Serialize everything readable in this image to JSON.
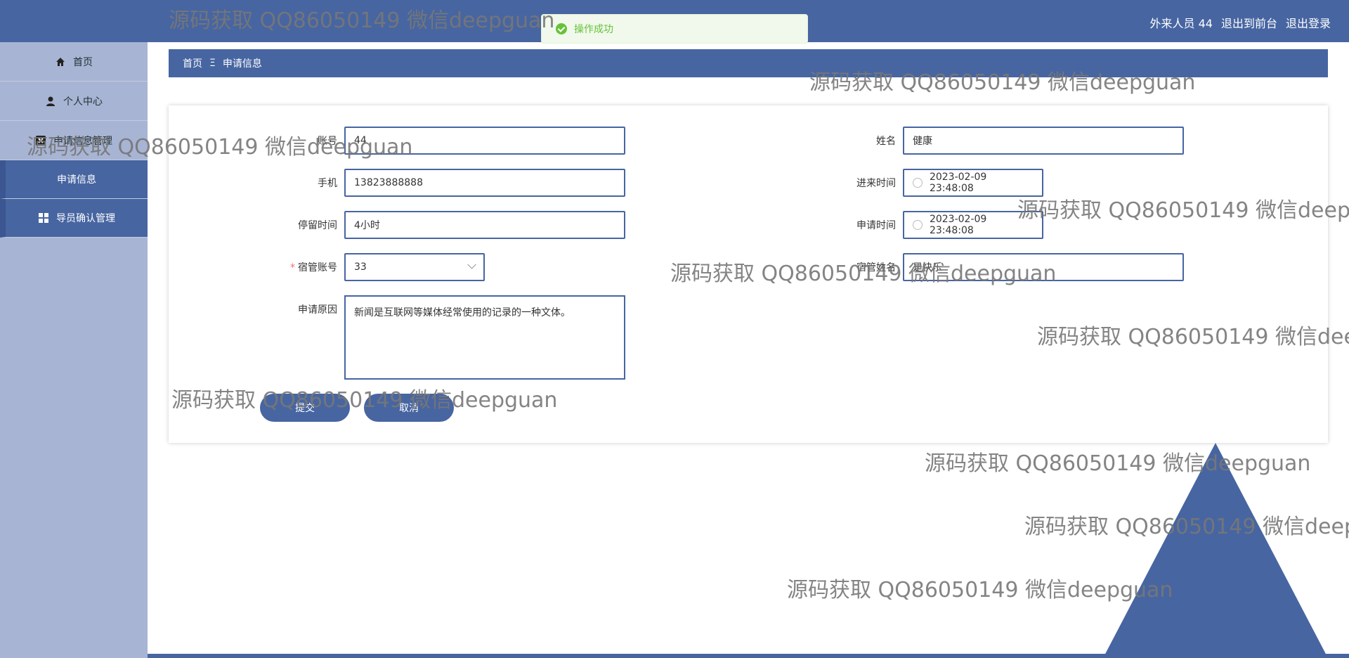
{
  "header": {
    "user": "外来人员 44",
    "links": [
      "退出到前台",
      "退出登录"
    ]
  },
  "toast": {
    "text": "操作成功"
  },
  "sidebar": {
    "items": [
      {
        "label": "首页",
        "icon": "home-icon"
      },
      {
        "label": "个人中心",
        "icon": "user-icon"
      },
      {
        "label": "申请信息管理",
        "icon": "close-square-icon"
      },
      {
        "label": "申请信息",
        "icon": ""
      },
      {
        "label": "导员确认管理",
        "icon": "grid-icon"
      }
    ]
  },
  "breadcrumb": {
    "home": "首页",
    "separator": "Ξ",
    "current": "申请信息"
  },
  "form": {
    "account": {
      "label": "账号",
      "value": "44"
    },
    "name": {
      "label": "姓名",
      "value": "健康"
    },
    "phone": {
      "label": "手机",
      "value": "13823888888"
    },
    "in_time": {
      "label": "进来时间",
      "value": "2023-02-09 23:48:08"
    },
    "stay": {
      "label": "停留时间",
      "value": "4小时"
    },
    "apply_time": {
      "label": "申请时间",
      "value": "2023-02-09 23:48:08"
    },
    "manager_account": {
      "label": "宿管账号",
      "value": "33",
      "required": true
    },
    "manager_name": {
      "label": "宿管姓名",
      "value": "是快乐"
    },
    "reason": {
      "label": "申请原因",
      "value": "新闻是互联网等媒体经常使用的记录的一种文体。"
    },
    "submit": "提交",
    "cancel": "取消"
  },
  "watermarks": [
    "源码获取 QQ86050149 微信deepguan",
    "源码获取 QQ86050149 微信deepguan",
    "源码获取 QQ86050149 微信deepguan",
    "源码获取 QQ86050149 微信deepg",
    "源码获取 QQ86050149 微信deepguan",
    "源码获取 QQ86050149 微信dee",
    "源码获取 QQ86050149 微信deepguan",
    "源码获取 QQ86050149 微信deepguan",
    "源码获取 QQ86050149 微信deep",
    "源码获取 QQ86050149 微信deepguan"
  ],
  "colors": {
    "accent": "#4765a1",
    "sidebar": "#a8b4d4",
    "success": "#67c23a"
  }
}
